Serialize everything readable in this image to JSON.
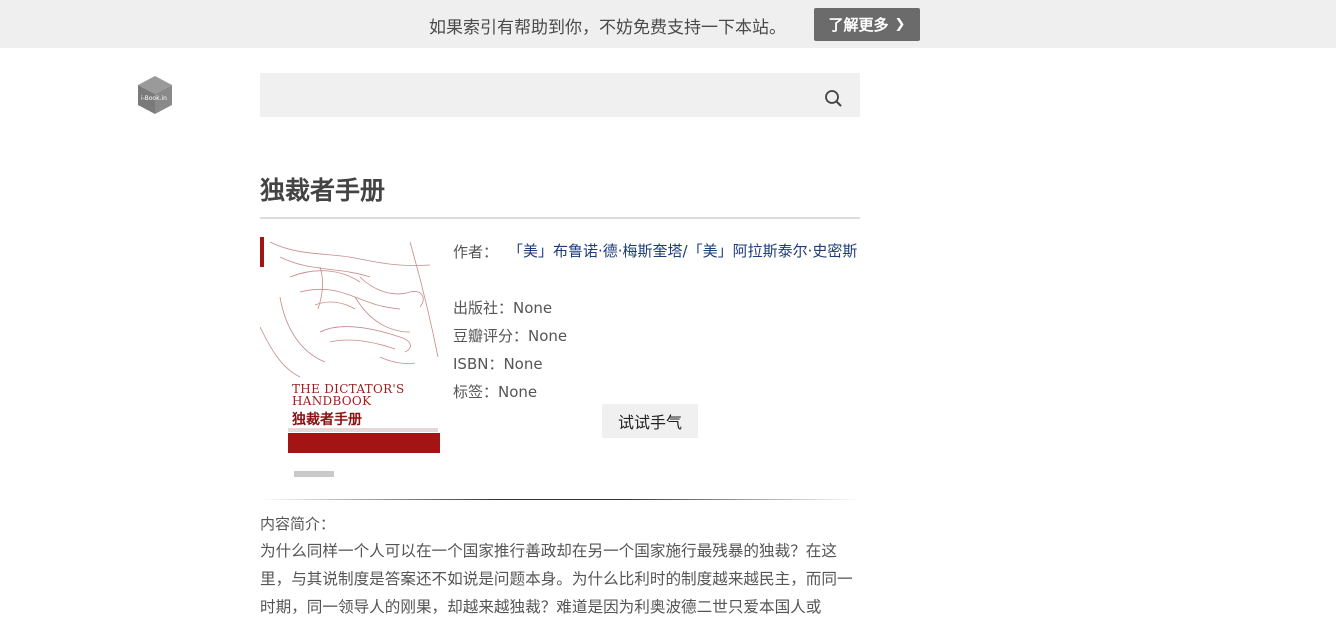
{
  "banner": {
    "text": "如果索引有帮助到你，不妨免费支持一下本站。",
    "button_label": "了解更多",
    "button_icon": "chevron-right-icon",
    "background": "#efefef",
    "button_color": "#6b6b6b"
  },
  "logo": {
    "text": "i-Book.in",
    "icon": "cube-logo"
  },
  "search": {
    "placeholder": "",
    "value": "",
    "icon": "search-icon"
  },
  "book": {
    "title": "独裁者手册",
    "cover": {
      "english_title_line1": "THE DICTATOR'S",
      "english_title_line2": "HANDBOOK",
      "chinese_title": "独裁者手册"
    },
    "author_label": "作者：",
    "author_value": "「美」布鲁诺·德·梅斯奎塔/「美」阿拉斯泰尔·史密斯",
    "publisher": "出版社：None",
    "douban_rating": "豆瓣评分：None",
    "isbn": "ISBN：None",
    "tags": "标签：None",
    "try_button": "试试手气",
    "link_color": "#1d3c7a"
  },
  "description": {
    "label": "内容简介：",
    "text": "为什么同样一个人可以在一个国家推行善政却在另一个国家施行最残暴的独裁？在这里，与其说制度是答案还不如说是问题本身。为什么比利时的制度越来越民主，而同一时期，同一领导人的刚果，却越来越独裁？难道是因为利奥波德二世只爱本国人或"
  }
}
